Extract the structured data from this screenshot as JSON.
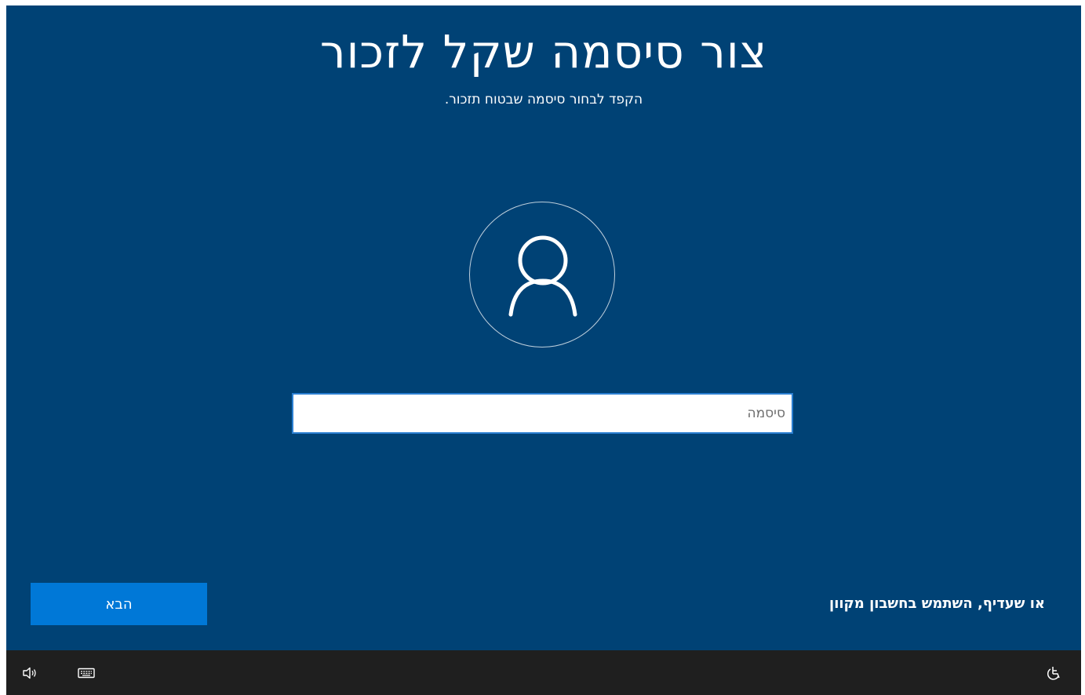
{
  "page": {
    "title": "צור סיסמה שקל לזכור",
    "subtitle": "הקפד לבחור סיסמה שבטוח תזכור."
  },
  "avatar": {
    "icon": "user-icon"
  },
  "password_field": {
    "placeholder": "סיסמה",
    "value": ""
  },
  "buttons": {
    "next_label": "הבא"
  },
  "links": {
    "online_account": "או שעדיף, השתמש בחשבון מקוון"
  },
  "taskbar": {
    "left_icons": [
      "volume-icon",
      "keyboard-icon"
    ],
    "right_icons": [
      "accessibility-icon"
    ]
  },
  "colors": {
    "background": "#004275",
    "button": "#0078d7",
    "taskbar": "#1f1f1f",
    "input_border": "#2b7fd1"
  }
}
